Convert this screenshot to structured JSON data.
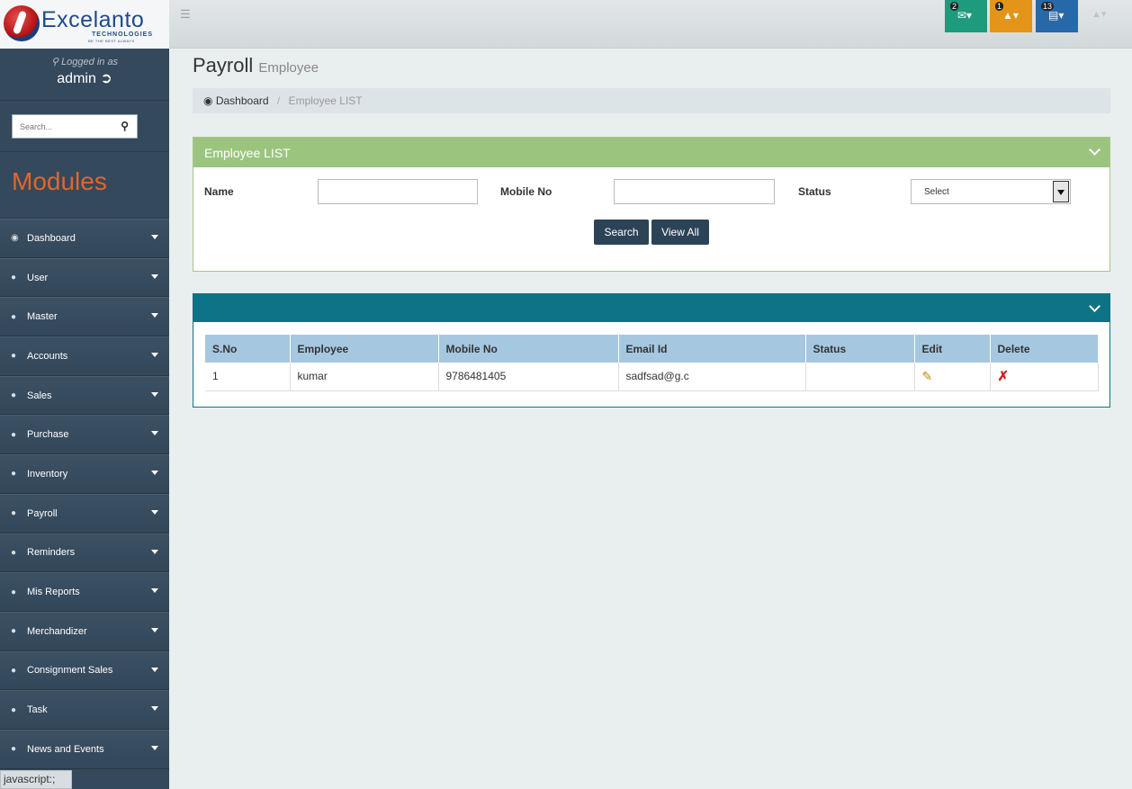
{
  "brand": {
    "name": "Excelanto",
    "sub": "TECHNOLOGIES",
    "tagline": "BE THE BEST ALWAYS"
  },
  "topbar": {
    "menu_icon": "hamburger-icon",
    "notifications": [
      {
        "count": "2",
        "icon": "envelope-icon",
        "color": "#1e9a7c"
      },
      {
        "count": "1",
        "icon": "bell-icon",
        "color": "#e39419"
      },
      {
        "count": "13",
        "icon": "tasks-icon",
        "color": "#2768a8"
      }
    ],
    "user_icon": "user-icon"
  },
  "sidebar": {
    "logged_in_label": "Logged in as",
    "username": "admin",
    "search_placeholder": "Search...",
    "modules_title": "Modules",
    "items": [
      {
        "label": "Dashboard",
        "icon": "dashboard-icon"
      },
      {
        "label": "User",
        "icon": "user-icon"
      },
      {
        "label": "Master",
        "icon": "user-icon"
      },
      {
        "label": "Accounts",
        "icon": "user-icon"
      },
      {
        "label": "Sales",
        "icon": "user-icon"
      },
      {
        "label": "Purchase",
        "icon": "user-icon"
      },
      {
        "label": "Inventory",
        "icon": "user-icon"
      },
      {
        "label": "Payroll",
        "icon": "user-icon"
      },
      {
        "label": "Reminders",
        "icon": "user-icon"
      },
      {
        "label": "Mis Reports",
        "icon": "user-icon"
      },
      {
        "label": "Merchandizer",
        "icon": "user-icon"
      },
      {
        "label": "Consignment Sales",
        "icon": "user-icon"
      },
      {
        "label": "Task",
        "icon": "user-icon"
      },
      {
        "label": "News and Events",
        "icon": "user-icon"
      }
    ]
  },
  "status_bar": "javascript:;",
  "page": {
    "title": "Payroll",
    "subtitle": "Employee",
    "breadcrumb": {
      "home": "Dashboard",
      "current": "Employee LIST"
    }
  },
  "filter_panel": {
    "title": "Employee LIST",
    "name_label": "Name",
    "name_value": "",
    "mobile_label": "Mobile No",
    "mobile_value": "",
    "status_label": "Status",
    "status_selected": "Select",
    "search_btn": "Search",
    "view_all_btn": "View All",
    "header_color": "#9bc57f"
  },
  "table": {
    "header_color": "#0f7388",
    "columns": [
      "S.No",
      "Employee",
      "Mobile No",
      "Email Id",
      "Status",
      "Edit",
      "Delete"
    ],
    "rows": [
      {
        "sno": "1",
        "employee": "kumar",
        "mobile": "9786481405",
        "email": "sadfsad@g.c",
        "status": ""
      }
    ]
  }
}
